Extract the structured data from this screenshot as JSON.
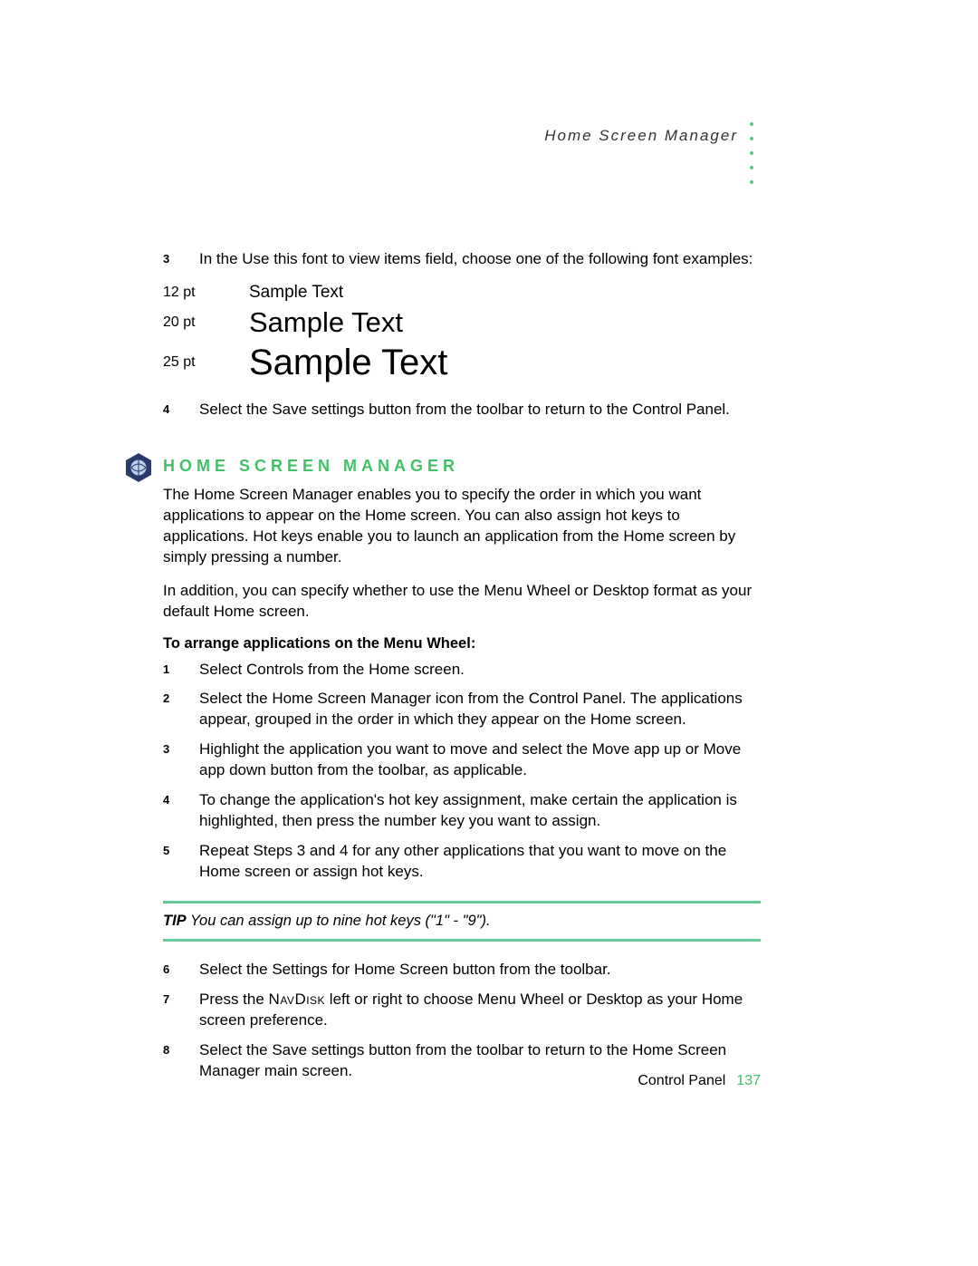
{
  "header": {
    "running_title": "Home Screen Manager"
  },
  "top_steps": [
    {
      "n": "3",
      "t": "In the Use this font to view items field, choose one of the following font examples:"
    }
  ],
  "font_samples": [
    {
      "label": "12 pt",
      "text": "Sample Text"
    },
    {
      "label": "20 pt",
      "text": "Sample Text"
    },
    {
      "label": "25 pt",
      "text": "Sample Text"
    }
  ],
  "after_samples": [
    {
      "n": "4",
      "t": "Select the Save settings button from the toolbar to return to the Control Panel."
    }
  ],
  "section": {
    "title": "HOME SCREEN MANAGER",
    "para1": "The Home Screen Manager enables you to specify the order in which you want applications to appear on the Home screen. You can also assign hot keys to applications. Hot keys enable you to launch an application from the Home screen by simply pressing a number.",
    "para2": "In addition, you can specify whether to use the Menu Wheel or Desktop format as your default Home screen.",
    "subhead": "To arrange applications on the Menu Wheel:",
    "steps_a": [
      {
        "n": "1",
        "t": "Select Controls from the Home screen."
      },
      {
        "n": "2",
        "t": "Select the Home Screen Manager icon from the Control Panel. The applications appear, grouped in the order in which they appear on the Home screen."
      },
      {
        "n": "3",
        "t": "Highlight the application you want to move and select the Move app up or Move app down button from the toolbar, as applicable."
      },
      {
        "n": "4",
        "t": "To change the application's hot key assignment, make certain the application is highlighted, then press the number key you want to assign."
      },
      {
        "n": "5",
        "t": "Repeat Steps 3 and 4 for any other applications that you want to move on the Home screen or assign hot keys."
      }
    ],
    "tip": {
      "label": "TIP",
      "text": " You can assign up to nine hot keys (\"1\" - \"9\")."
    },
    "steps_b": [
      {
        "n": "6",
        "t": "Select the Settings for Home Screen button from the toolbar."
      },
      {
        "n": "7",
        "pre": "Press the ",
        "sc": "NavDisk",
        "post": " left or right to choose Menu Wheel or Desktop as your Home screen preference."
      },
      {
        "n": "8",
        "t": "Select the Save settings button from the toolbar to return to the Home Screen Manager main screen."
      }
    ]
  },
  "footer": {
    "section": "Control Panel",
    "page": "137"
  }
}
